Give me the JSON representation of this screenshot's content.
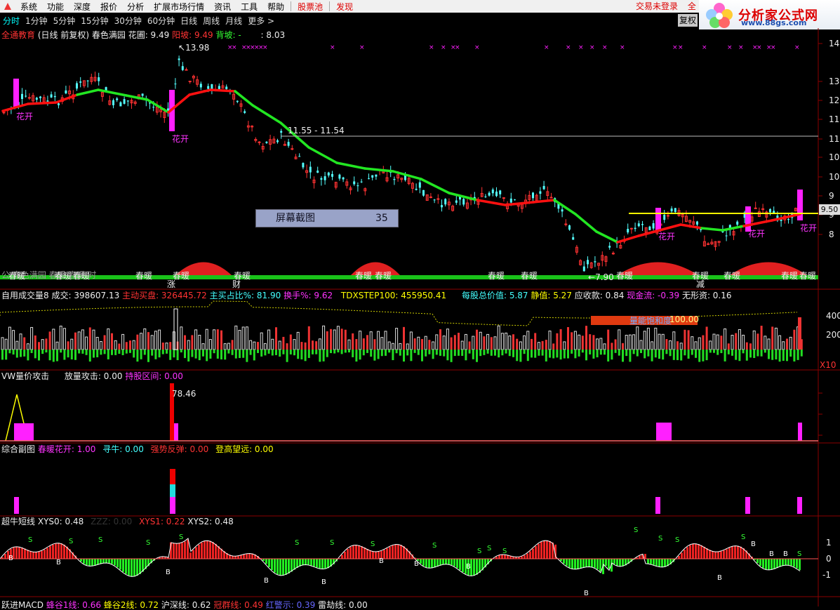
{
  "menu": {
    "items": [
      "系统",
      "功能",
      "深度",
      "报价",
      "分析",
      "扩展市场行情",
      "资讯",
      "工具",
      "帮助"
    ],
    "stock_pool": "股票池",
    "alert": "发现",
    "login_status": "交易未登录",
    "login_extra": "全"
  },
  "brand": {
    "title": "分析家公式网",
    "url": "www.88gs.com"
  },
  "periods": {
    "items": [
      "分时",
      "1分钟",
      "5分钟",
      "15分钟",
      "30分钟",
      "60分钟",
      "日线",
      "周线",
      "月线",
      "更多 >"
    ],
    "active": 0
  },
  "fq_button": "复权",
  "main_header": {
    "left": "全通教育",
    "period": "(日线 前复权)",
    "indicator": "春色满园",
    "huaquan": "花圃: 9.49",
    "yangpo": "阳坡: 9.49",
    "beipo": "背坡: -",
    "tail": ": 8.03"
  },
  "price_axis": {
    "labels": [
      "14",
      "13",
      "12",
      "11",
      "11",
      "10",
      "10",
      "9",
      "9",
      "8"
    ]
  },
  "annotations": {
    "high": "13.98",
    "low": "7.90",
    "level_line": "11.55 - 11.54",
    "current": "9.50",
    "huakai": "花开",
    "chunnuan": "春暖",
    "rise": "涨",
    "cai": "财",
    "jian": "减",
    "faded": "公 春色满园 春暖 春暖 时"
  },
  "screenshot_badge": {
    "label": "屏幕截图",
    "value": "35"
  },
  "volume_header": {
    "name": "自用成交量8",
    "vol": "成交: 398607.13",
    "active_buy": "主动买盘: 326445.72",
    "buy_ratio": "主买占比%: 81.90",
    "turnover": "换手%: 9.62",
    "tdx": "TDXSTEP100: 455950.41",
    "mgzj": "每股总价值: 5.87",
    "jz": "静值: 5.27",
    "ysk": "应收款: 0.84",
    "xjl": "现金流: -0.39",
    "wxz": "无形资: 0.16"
  },
  "volume_full": {
    "label": "量能饱和度",
    "value": "100.00"
  },
  "volume_axis": {
    "labels": [
      "400",
      "200"
    ],
    "unit": "X10"
  },
  "vw_header": {
    "name": "VW量价攻击",
    "attack": "放量攻击: 0.00",
    "hold": "持股区间: 0.00",
    "peak": "78.46"
  },
  "zh_header": {
    "name": "综合副图",
    "cnhk": "春暖花开: 1.00",
    "xn": "寻牛: 0.00",
    "qsft": "强势反弹: 0.00",
    "dgwy": "登高望远: 0.00"
  },
  "cn_header": {
    "name": "超牛短线",
    "xys0": "XYS0: 0.48",
    "zzz": "ZZZ: 0.00",
    "xys1": "XYS1: 0.22",
    "xys2": "XYS2: 0.48"
  },
  "macd_header": {
    "name": "跃进MACD",
    "f1": "蜂谷1线: 0.66",
    "f2": "蜂谷2线: 0.72",
    "f3": "沪深线: 0.62",
    "f4": "冠群线: 0.49",
    "f5": "红警示: 0.39",
    "f6": "雷劫线: 0.00"
  },
  "colors": {
    "up": "#ff3232",
    "down": "#54ffff",
    "ma_up": "#ff1010",
    "ma_down": "#22e622",
    "magenta": "#ff20ff",
    "bg": "#000000",
    "grid": "#8b0000"
  }
}
